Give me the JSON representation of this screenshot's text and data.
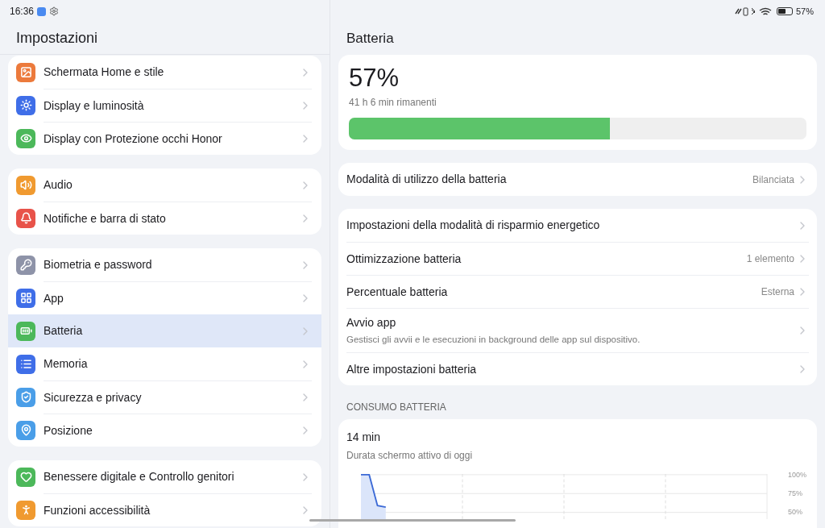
{
  "status_bar": {
    "time": "16:36",
    "battery_text": "57%"
  },
  "sidebar": {
    "title": "Impostazioni",
    "groups": [
      {
        "items": [
          {
            "label": "Schermata Home e stile",
            "color": "#ec7a3c",
            "selected": false
          },
          {
            "label": "Display e luminosità",
            "color": "#3f6ee8",
            "selected": false
          },
          {
            "label": "Display con Protezione occhi Honor",
            "color": "#4cb85a",
            "selected": false
          }
        ]
      },
      {
        "items": [
          {
            "label": "Audio",
            "color": "#f09a30",
            "selected": false
          },
          {
            "label": "Notifiche e barra di stato",
            "color": "#e8534a",
            "selected": false
          }
        ]
      },
      {
        "items": [
          {
            "label": "Biometria e password",
            "color": "#8e93a8",
            "selected": false
          },
          {
            "label": "App",
            "color": "#3f6ee8",
            "selected": false
          },
          {
            "label": "Batteria",
            "color": "#4cb85a",
            "selected": true
          },
          {
            "label": "Memoria",
            "color": "#3f6ee8",
            "selected": false
          },
          {
            "label": "Sicurezza e privacy",
            "color": "#4a9ee8",
            "selected": false
          },
          {
            "label": "Posizione",
            "color": "#4a9ee8",
            "selected": false
          }
        ]
      },
      {
        "items": [
          {
            "label": "Benessere digitale e Controllo genitori",
            "color": "#4cb85a",
            "selected": false
          },
          {
            "label": "Funzioni accessibilità",
            "color": "#f09a30",
            "selected": false
          }
        ]
      }
    ]
  },
  "main": {
    "title": "Batteria",
    "summary": {
      "percent": "57%",
      "remaining": "41 h 6 min rimanenti",
      "level": 0.57
    },
    "groups": [
      {
        "items": [
          {
            "label": "Modalità di utilizzo della batteria",
            "value": "Bilanciata"
          }
        ]
      },
      {
        "items": [
          {
            "label": "Impostazioni della modalità di risparmio energetico"
          },
          {
            "label": "Ottimizzazione batteria",
            "value": "1 elemento"
          },
          {
            "label": "Percentuale batteria",
            "value": "Esterna"
          },
          {
            "label": "Avvio app",
            "subtitle": "Gestisci gli avvii e le esecuzioni in background delle app sul dispositivo."
          },
          {
            "label": "Altre impostazioni batteria"
          }
        ]
      }
    ],
    "usage": {
      "section_title": "CONSUMO BATTERIA",
      "value": "14 min",
      "caption": "Durata schermo attivo di oggi",
      "axis_labels": [
        "100%",
        "75%",
        "50%"
      ]
    }
  }
}
